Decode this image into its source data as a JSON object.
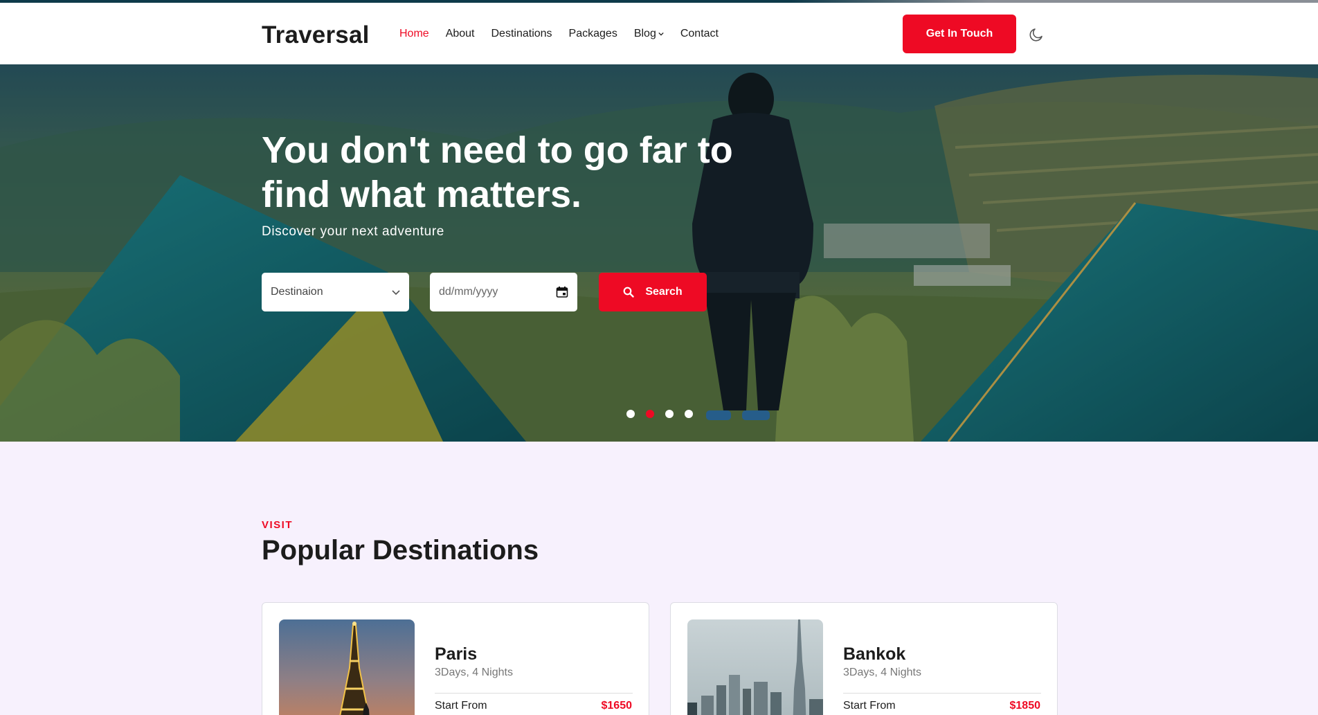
{
  "brand": {
    "name": "Traversal",
    "accent": "#ee0a24"
  },
  "nav": {
    "items": [
      {
        "label": "Home",
        "active": true
      },
      {
        "label": "About"
      },
      {
        "label": "Destinations"
      },
      {
        "label": "Packages"
      },
      {
        "label": "Blog",
        "has_dropdown": true
      },
      {
        "label": "Contact"
      }
    ],
    "cta_label": "Get In Touch",
    "theme_icon": "moon-icon"
  },
  "hero": {
    "title": "You don't need to go far to find what matters.",
    "subtitle": "Discover your next adventure",
    "search": {
      "destination_value": "Destinaion",
      "date_placeholder": "dd/mm/yyyy",
      "button_label": "Search"
    },
    "carousel": {
      "slides": 4,
      "active_index": 1
    }
  },
  "destinations": {
    "eyebrow": "VISIT",
    "title": "Popular Destinations",
    "cards": [
      {
        "name": "Paris",
        "duration": "3Days, 4 Nights",
        "start_label": "Start From",
        "price": "$1650"
      },
      {
        "name": "Bankok",
        "duration": "3Days, 4 Nights",
        "start_label": "Start From",
        "price": "$1850"
      }
    ]
  }
}
